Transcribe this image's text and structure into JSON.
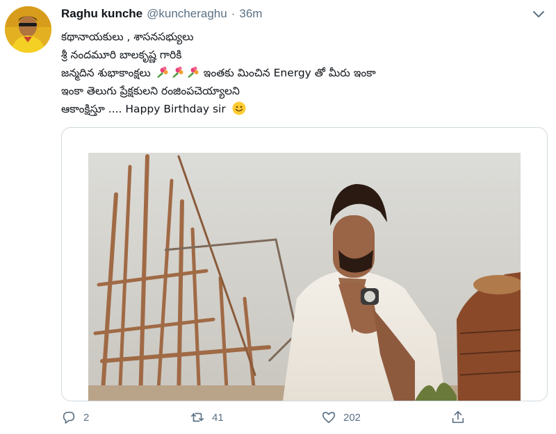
{
  "tweet": {
    "author_name": "Raghu kunche",
    "author_handle": "@kuncheraghu",
    "separator": "·",
    "time_ago": "36m",
    "lines": {
      "l1": "కథానాయకులు , శాసనసభ్యులు",
      "l2": "శ్రీ నందమూరి బాలకృష్ణ గారికి",
      "l3a": "జన్మదిన శుభాకాంక్షలు",
      "l3b": "ఇంతకు మించిన Energy తో మీరు ఇంకా",
      "l4": "ఇంకా తెలుగు ప్రేక్షకులని రంజింపచెయ్యాలని",
      "l5": "ఆకాంక్షిస్తూ .... Happy Birthday sir"
    },
    "emoji": [
      "bouquet",
      "bouquet",
      "bouquet",
      "slightly-smiling-face"
    ]
  },
  "actions": {
    "replies": "2",
    "retweets": "41",
    "likes": "202"
  },
  "icons": {
    "reply": "reply-icon",
    "retweet": "retweet-icon",
    "like": "heart-icon",
    "share": "share-icon",
    "more": "chevron-down-icon"
  },
  "colors": {
    "text": "#0f1419",
    "secondary": "#5b7083",
    "border": "#cfd9de"
  }
}
